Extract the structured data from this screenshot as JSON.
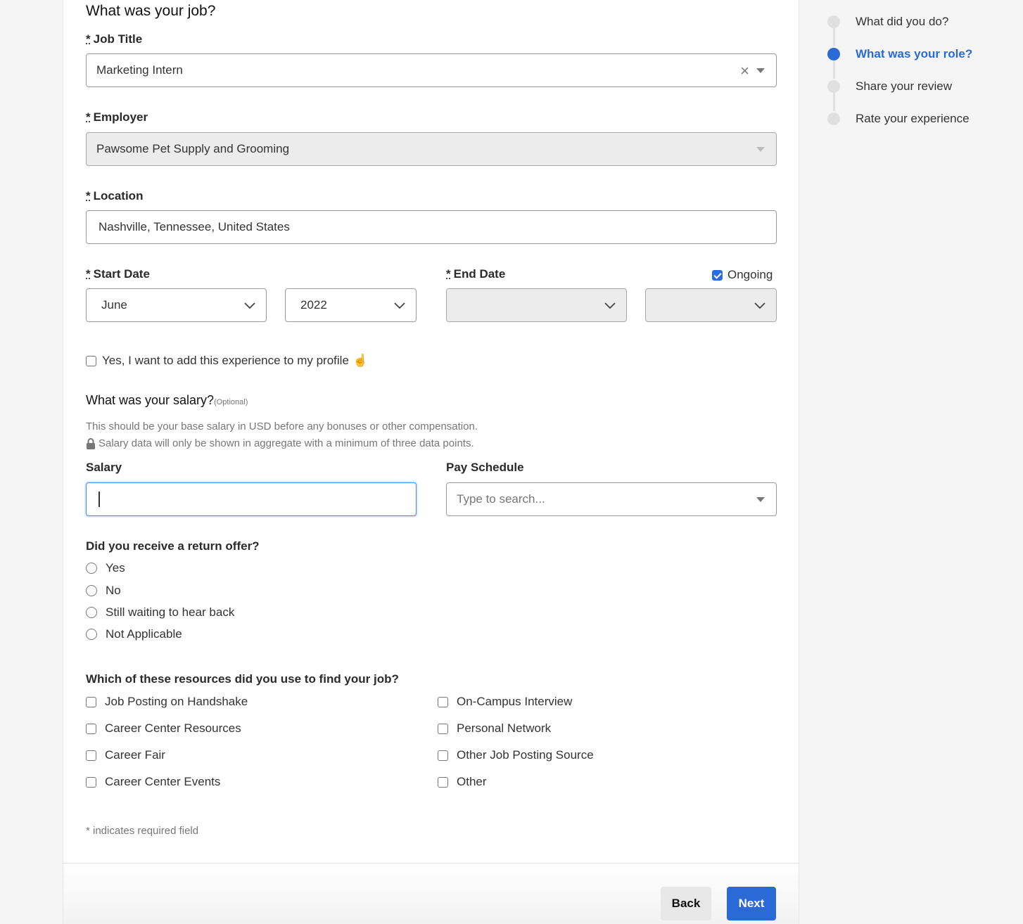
{
  "form": {
    "title": "What was your job?",
    "required_marker": "*",
    "job_title": {
      "label": "Job Title",
      "value": "Marketing Intern",
      "clear_icon": "×"
    },
    "employer": {
      "label": "Employer",
      "value": "Pawsome Pet Supply and Grooming"
    },
    "location": {
      "label": "Location",
      "value": "Nashville, Tennessee, United States"
    },
    "start_date": {
      "label": "Start Date",
      "month": "June",
      "year": "2022"
    },
    "end_date": {
      "label": "End Date",
      "month": "",
      "year": "",
      "ongoing_label": "Ongoing",
      "ongoing_checked": true
    },
    "add_to_profile": {
      "label": "Yes, I want to add this experience to my profile",
      "emoji": "☝️",
      "checked": false
    },
    "salary_section": {
      "title": "What was your salary?",
      "optional": "(Optional)",
      "help_1": "This should be your base salary in USD before any bonuses or other compensation.",
      "help_2": "Salary data will only be shown in aggregate with a minimum of three data points.",
      "salary_label": "Salary",
      "salary_value": "",
      "pay_schedule_label": "Pay Schedule",
      "pay_schedule_placeholder": "Type to search..."
    },
    "return_offer": {
      "question": "Did you receive a return offer?",
      "options": [
        "Yes",
        "No",
        "Still waiting to hear back",
        "Not Applicable"
      ]
    },
    "resources": {
      "question": "Which of these resources did you use to find your job?",
      "left": [
        "Job Posting on Handshake",
        "Career Center Resources",
        "Career Fair",
        "Career Center Events"
      ],
      "right": [
        "On-Campus Interview",
        "Personal Network",
        "Other Job Posting Source",
        "Other"
      ]
    },
    "required_note": "* indicates required field"
  },
  "footer": {
    "back_label": "Back",
    "next_label": "Next"
  },
  "stepper": {
    "steps": [
      {
        "label": "What did you do?",
        "active": false
      },
      {
        "label": "What was your role?",
        "active": true
      },
      {
        "label": "Share your review",
        "active": false
      },
      {
        "label": "Rate your experience",
        "active": false
      }
    ]
  },
  "colors": {
    "accent": "#2b6ad6",
    "disabled_bg": "#ececec",
    "page_bg": "#f5f5f5"
  }
}
